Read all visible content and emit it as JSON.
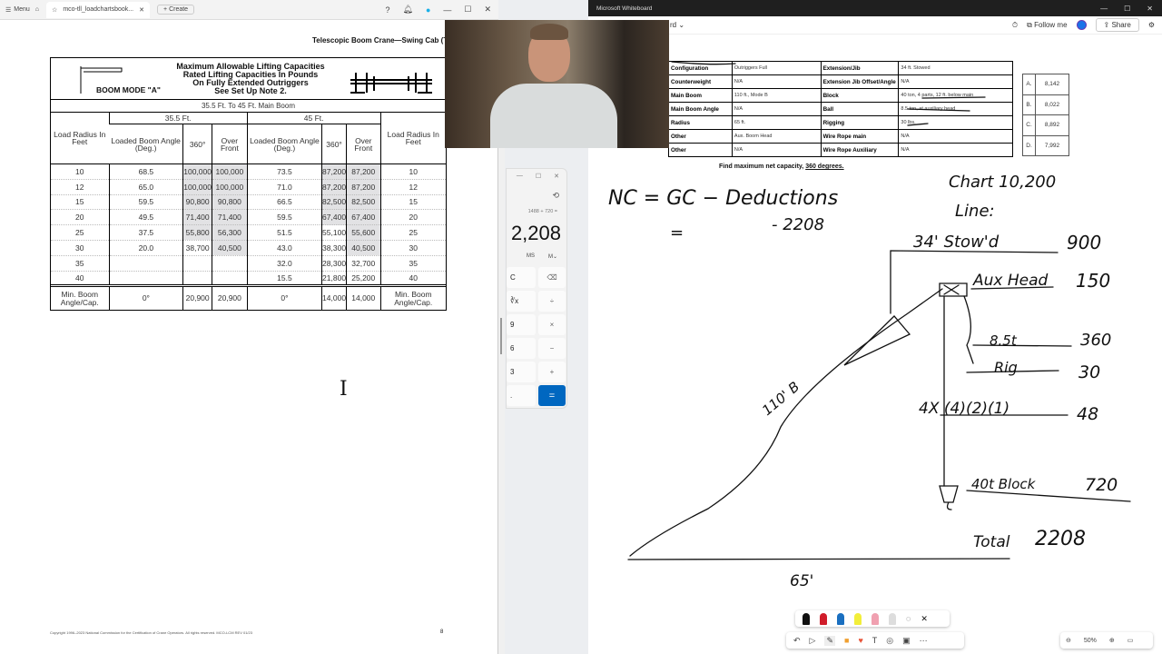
{
  "pdf_app": {
    "menu_label": "Menu",
    "tab_title": "mco-tll_loadchartsbook...",
    "create_label": "Create",
    "doc_header": "Telescopic Boom Crane—Swing Cab (TLL)",
    "chart": {
      "title_lines": [
        "Maximum Allowable Lifting Capacities",
        "Rated Lifting Capacities In Pounds",
        "On Fully Extended Outriggers",
        "See Set Up Note 2."
      ],
      "boom_mode": "BOOM MODE \"A\"",
      "subtitle": "35.5 Ft. To 45 Ft. Main Boom",
      "group_headers": [
        "35.5 Ft.",
        "45 Ft."
      ],
      "col_radius": "Load Radius In Feet",
      "col_angle": "Loaded Boom Angle (Deg.)",
      "col_360": "360°",
      "col_front": "Over Front",
      "rows": [
        {
          "r": "10",
          "a1": "68.5",
          "c1": "100,000",
          "f1": "100,000",
          "a2": "73.5",
          "c2": "87,200",
          "f2": "87,200"
        },
        {
          "r": "12",
          "a1": "65.0",
          "c1": "100,000",
          "f1": "100,000",
          "a2": "71.0",
          "c2": "87,200",
          "f2": "87,200"
        },
        {
          "r": "15",
          "a1": "59.5",
          "c1": "90,800",
          "f1": "90,800",
          "a2": "66.5",
          "c2": "82,500",
          "f2": "82,500"
        },
        {
          "r": "20",
          "a1": "49.5",
          "c1": "71,400",
          "f1": "71,400",
          "a2": "59.5",
          "c2": "67,400",
          "f2": "67,400"
        },
        {
          "r": "25",
          "a1": "37.5",
          "c1": "55,800",
          "f1": "56,300",
          "a2": "51.5",
          "c2": "55,100",
          "f2": "55,600"
        },
        {
          "r": "30",
          "a1": "20.0",
          "c1": "38,700",
          "f1": "40,500",
          "a2": "43.0",
          "c2": "38,300",
          "f2": "40,500"
        },
        {
          "r": "35",
          "a1": "",
          "c1": "",
          "f1": "",
          "a2": "32.0",
          "c2": "28,300",
          "f2": "32,700"
        },
        {
          "r": "40",
          "a1": "",
          "c1": "",
          "f1": "",
          "a2": "15.5",
          "c2": "21,800",
          "f2": "25,200"
        }
      ],
      "shaded_rows": {
        "c1": [
          "10",
          "12",
          "15",
          "20",
          "25"
        ],
        "f1": [
          "10",
          "12",
          "15",
          "20",
          "25",
          "30"
        ],
        "c2": [
          "10",
          "12",
          "15",
          "20"
        ],
        "f2": [
          "10",
          "12",
          "15",
          "20",
          "25",
          "30"
        ]
      },
      "min_row": {
        "label": "Min. Boom Angle/Cap.",
        "a1": "0°",
        "c1": "20,900",
        "f1": "20,900",
        "a2": "0°",
        "c2": "14,000",
        "f2": "14,000"
      }
    },
    "footer": "Copyright 1996–2023 National Commission for the Certification of Crane Operators. All rights reserved. MCO-LCM REV 01/23",
    "page_number": "8"
  },
  "calculator": {
    "expression": "1488 + 720 =",
    "value": "2,208",
    "mem": [
      "MS",
      "M⌄"
    ],
    "buttons": [
      "C",
      "⌫",
      "∛x",
      "÷",
      "9",
      "×",
      "6",
      "−",
      "3",
      "+",
      ".",
      "="
    ]
  },
  "whiteboard": {
    "window_title": "Microsoft Whiteboard",
    "board_name": "rd",
    "follow_label": "Follow me",
    "share_label": "Share",
    "question_table": [
      [
        "Configuration",
        "Outriggers Full",
        "Extension/Jib",
        "34 ft. Stowed"
      ],
      [
        "Counterweight",
        "N/A",
        "Extension Jib Offset/Angle",
        "N/A"
      ],
      [
        "Main Boom",
        "110 ft., Mode B",
        "Block",
        "40 ton, 4 parts, 12 ft. below main"
      ],
      [
        "Main Boom Angle",
        "N/A",
        "Ball",
        "8.5 ton, at auxiliary head"
      ],
      [
        "Radius",
        "65 ft.",
        "Rigging",
        "30 lbs."
      ],
      [
        "Other",
        "Aux. Boom Head",
        "Wire Rope main",
        "N/A"
      ],
      [
        "Other",
        "N/A",
        "Wire Rope Auxiliary",
        "N/A"
      ]
    ],
    "question_prefix": "Find maximum net capacity, ",
    "question_emph": "360 degrees.",
    "answers": [
      [
        "A.",
        "8,142"
      ],
      [
        "B.",
        "8,022"
      ],
      [
        "C.",
        "8,892"
      ],
      [
        "D.",
        "7,992"
      ]
    ],
    "handwriting": {
      "formula": "NC = GC − Deductions",
      "formula2": "=",
      "minus": "- 2208",
      "chart": "Chart 10,200",
      "line": "Line:",
      "stowed": "34' Stow'd",
      "stowed_v": "900",
      "aux": "Aux Head",
      "aux_v": "150",
      "ball": "8.5t",
      "ball_v": "360",
      "rig": "Rig",
      "rig_v": "30",
      "parts": "4X (4)(2)(1)",
      "parts_v": "48",
      "block": "40t Block",
      "block_v": "720",
      "total": "Total",
      "total_v": "2208",
      "radius": "65'",
      "boom": "110' B"
    },
    "zoom": "50%",
    "pen_colors": [
      "#111111",
      "#d01c2a",
      "#1a6fc0",
      "#f2ee3a",
      "#f0a0b0"
    ]
  }
}
